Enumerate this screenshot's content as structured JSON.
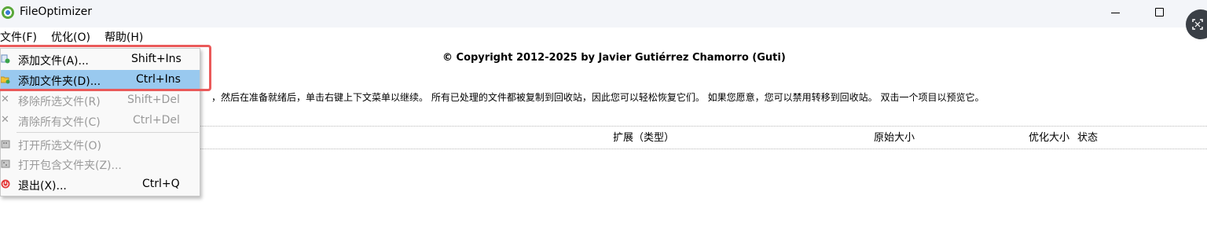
{
  "window": {
    "title": "FileOptimizer",
    "icon": "fileoptimizer-icon"
  },
  "menubar": {
    "items": [
      {
        "label": "文件(F)"
      },
      {
        "label": "优化(O)"
      },
      {
        "label": "帮助(H)"
      }
    ]
  },
  "content": {
    "copyright": "© Copyright 2012-2025 by Javier Gutiérrez Chamorro (Guti)",
    "info": "，然后在准备就绪后，单击右键上下文菜单以继续。 所有已处理的文件都被复制到回收站，因此您可以轻松恢复它们。 如果您愿意，您可以禁用转移到回收站。 双击一个项目以预览它。"
  },
  "table": {
    "columns": {
      "extension": "扩展（类型）",
      "original_size": "原始大小",
      "optimized_size": "优化大小",
      "status": "状态"
    }
  },
  "popup_menu": {
    "items": [
      {
        "label": "添加文件(A)...",
        "shortcut": "Shift+Ins",
        "icon": "add-file-icon",
        "enabled": true,
        "selected": false
      },
      {
        "label": "添加文件夹(D)...",
        "shortcut": "Ctrl+Ins",
        "icon": "add-folder-icon",
        "enabled": true,
        "selected": true
      },
      {
        "label": "移除所选文件(R)",
        "shortcut": "Shift+Del",
        "icon": "remove-icon",
        "enabled": false,
        "selected": false
      },
      {
        "label": "清除所有文件(C)",
        "shortcut": "Ctrl+Del",
        "icon": "clear-icon",
        "enabled": false,
        "selected": false
      },
      {
        "label": "打开所选文件(O)",
        "shortcut": "",
        "icon": "open-file-icon",
        "enabled": false,
        "selected": false
      },
      {
        "label": "打开包含文件夹(Z)...",
        "shortcut": "",
        "icon": "open-folder-icon",
        "enabled": false,
        "selected": false
      },
      {
        "label": "退出(X)...",
        "shortcut": "Ctrl+Q",
        "icon": "power-icon",
        "enabled": true,
        "selected": false
      }
    ]
  },
  "colors": {
    "selection": "#99c9ef",
    "highlight_annotation": "#ea5a5a",
    "disabled_text": "#9a9a9a"
  }
}
